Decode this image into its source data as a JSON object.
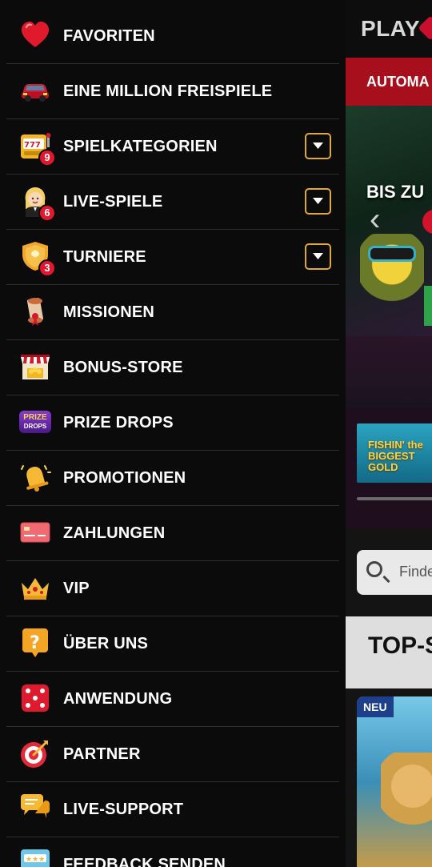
{
  "background": {
    "logo_text": "PLAY",
    "redbar_text": "AUTOMA",
    "banner_text": "BIS ZU",
    "thumb_text": "FISHIN' the BIGGEST GOLD",
    "search_placeholder": "Finde",
    "section_title": "TOP-S",
    "badge_new": "NEU"
  },
  "menu": {
    "items": [
      {
        "label": "FAVORITEN",
        "icon": "heart-icon"
      },
      {
        "label": "EINE MILLION FREISPIELE",
        "icon": "car-icon"
      },
      {
        "label": "SPIELKATEGORIEN",
        "icon": "slot-machine-icon",
        "badge": "9",
        "expandable": true
      },
      {
        "label": "LIVE-SPIELE",
        "icon": "live-dealer-icon",
        "badge": "6",
        "expandable": true
      },
      {
        "label": "TURNIERE",
        "icon": "shield-icon",
        "badge": "3",
        "expandable": true
      },
      {
        "label": "MISSIONEN",
        "icon": "scroll-icon"
      },
      {
        "label": "BONUS-STORE",
        "icon": "store-icon"
      },
      {
        "label": "PRIZE DROPS",
        "icon": "prize-drops-icon"
      },
      {
        "label": "PROMOTIONEN",
        "icon": "bell-icon"
      },
      {
        "label": "ZAHLUNGEN",
        "icon": "credit-card-icon"
      },
      {
        "label": "VIP",
        "icon": "crown-icon"
      },
      {
        "label": "ÜBER UNS",
        "icon": "question-icon"
      },
      {
        "label": "ANWENDUNG",
        "icon": "dice-icon"
      },
      {
        "label": "PARTNER",
        "icon": "target-icon"
      },
      {
        "label": "LIVE-SUPPORT",
        "icon": "chat-icon"
      },
      {
        "label": "FEEDBACK SENDEN",
        "icon": "rating-icon"
      }
    ],
    "prize_drops_logo": {
      "line1": "PRIZE",
      "line2": "DROPS"
    }
  },
  "colors": {
    "accent": "#e2a930",
    "badge": "#e1172f",
    "drawer_bg": "#0b0b0b",
    "divider": "#2e2e2e"
  }
}
